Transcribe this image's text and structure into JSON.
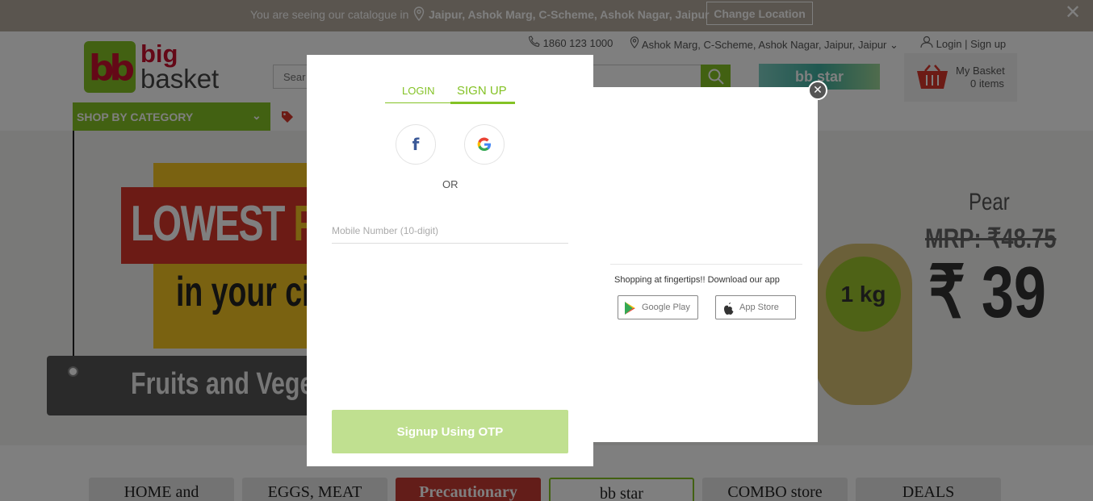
{
  "notice": {
    "text": "You are seeing our catalogue in",
    "location": "Jaipur, Ashok Marg, C-Scheme, Ashok Nagar, Jaipur",
    "change_label": "Change Location",
    "close": "✕"
  },
  "header": {
    "logo_big": "big",
    "logo_basket": "basket",
    "phone": "1860 123 1000",
    "location": "Ashok Marg, C-Scheme, Ashok Nagar, Jaipur, Jaipur",
    "login": "Login",
    "signup": "Sign up",
    "search_placeholder": "Sear",
    "bbstar": "bb star",
    "cart_title": "My Basket",
    "cart_items": "0 items",
    "shop_by_category": "SHOP BY CATEGORY"
  },
  "hero": {
    "lowest": "LOWEST ",
    "pri": "PRI",
    "city": "in your cit",
    "fruits": "Fruits and Vege",
    "kg": "1 kg",
    "pear": "Pear",
    "mrp": "MRP: ₹48.75",
    "price": "₹ 39"
  },
  "tiles": [
    "HOME and",
    "EGGS, MEAT",
    "Precautionary",
    "bb star",
    "COMBO store",
    "DEALS"
  ],
  "modal": {
    "tab_login": "LOGIN",
    "tab_signup": "SIGN UP",
    "or": "OR",
    "mobile_placeholder": "Mobile Number (10-digit)",
    "otp_button": "Signup Using OTP",
    "app_text": "Shopping at fingertips!! Download our app",
    "google_play": "Google Play",
    "app_store": "App Store",
    "close": "✕"
  },
  "colors": {
    "brand_green": "#84c225",
    "brand_red": "#c8102e",
    "otp_button": "#c0e090"
  }
}
